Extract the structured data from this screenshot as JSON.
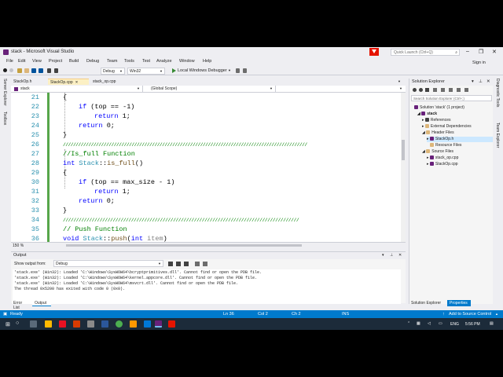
{
  "window": {
    "title": "stack - Microsoft Visual Studio",
    "quick_launch_placeholder": "Quick Launch (Ctrl+Q)",
    "sign_in": "Sign in"
  },
  "menu": [
    "File",
    "Edit",
    "View",
    "Project",
    "Build",
    "Debug",
    "Team",
    "Tools",
    "Test",
    "Analyze",
    "Window",
    "Help"
  ],
  "toolbar": {
    "configuration": "Debug",
    "platform": "Win32",
    "debugger": "Local Windows Debugger"
  },
  "left_tabs": [
    "Server Explorer",
    "Toolbox"
  ],
  "right_tabs": [
    "Diagnostic Tools",
    "Team Explorer"
  ],
  "doc_tabs": [
    "StackOp.h",
    "StackOp.cpp",
    "stack_op.cpp"
  ],
  "navbar": {
    "project": "stack",
    "scope": "(Global Scope)"
  },
  "editor": {
    "zoom": "150 %",
    "lines": [
      {
        "num": "21",
        "text": "{"
      },
      {
        "num": "22",
        "text": "if (top == -1)"
      },
      {
        "num": "23",
        "text": "return 1;"
      },
      {
        "num": "24",
        "text": "return 0;"
      },
      {
        "num": "25",
        "text": "}"
      },
      {
        "num": "26",
        "text": "////////////////////////////////////////////////////////////////////////////////////////////////"
      },
      {
        "num": "27",
        "text": "//Is_full Function"
      },
      {
        "num": "28",
        "text": "int Stack::is_full()"
      },
      {
        "num": "29",
        "text": "{"
      },
      {
        "num": "30",
        "text": "if (top == max_size - 1)"
      },
      {
        "num": "31",
        "text": "return 1;"
      },
      {
        "num": "32",
        "text": "return 0;"
      },
      {
        "num": "33",
        "text": "}"
      },
      {
        "num": "34",
        "text": "//////////////////////////////////////////////////////////////////////////////////////////"
      },
      {
        "num": "35",
        "text": "// Push Function"
      },
      {
        "num": "36",
        "text": "void Stack::push(int item)"
      }
    ]
  },
  "output": {
    "title": "Output",
    "show_from_label": "Show output from:",
    "show_from_value": "Debug",
    "lines": [
      "'stack.exe' (Win32): Loaded 'C:\\Windows\\SysWOW64\\bcryptprimitives.dll'. Cannot find or open the PDB file.",
      "'stack.exe' (Win32): Loaded 'C:\\Windows\\SysWOW64\\kernel.appcore.dll'. Cannot find or open the PDB file.",
      "'stack.exe' (Win32): Loaded 'C:\\Windows\\SysWOW64\\msvcrt.dll'. Cannot find or open the PDB file.",
      "The thread 0x5200 has exited with code 0 (0x0)."
    ]
  },
  "bottom_tabs": [
    "Error List",
    "Output"
  ],
  "solution_explorer": {
    "title": "Solution Explorer",
    "search_placeholder": "Search Solution Explorer (Ctrl+;)",
    "items": [
      {
        "label": "Solution 'stack' (1 project)"
      },
      {
        "label": "stack"
      },
      {
        "label": "References"
      },
      {
        "label": "External Dependencies"
      },
      {
        "label": "Header Files"
      },
      {
        "label": "StackOp.h"
      },
      {
        "label": "Resource Files"
      },
      {
        "label": "Source Files"
      },
      {
        "label": "stack_op.cpp"
      },
      {
        "label": "StackOp.cpp"
      }
    ],
    "tabs": [
      "Solution Explorer",
      "Properties"
    ]
  },
  "status": {
    "ready": "Ready",
    "ln": "Ln 36",
    "col": "Col 2",
    "ch": "Ch 2",
    "ins": "INS",
    "source_control": "Add to Source Control"
  },
  "taskbar": {
    "lang": "ENG",
    "time": "5:56 PM"
  },
  "colors": {
    "accent": "#007acc",
    "keyword": "#0000ff",
    "comment": "#008000",
    "type": "#2b91af",
    "line_number": "#2b91af"
  }
}
